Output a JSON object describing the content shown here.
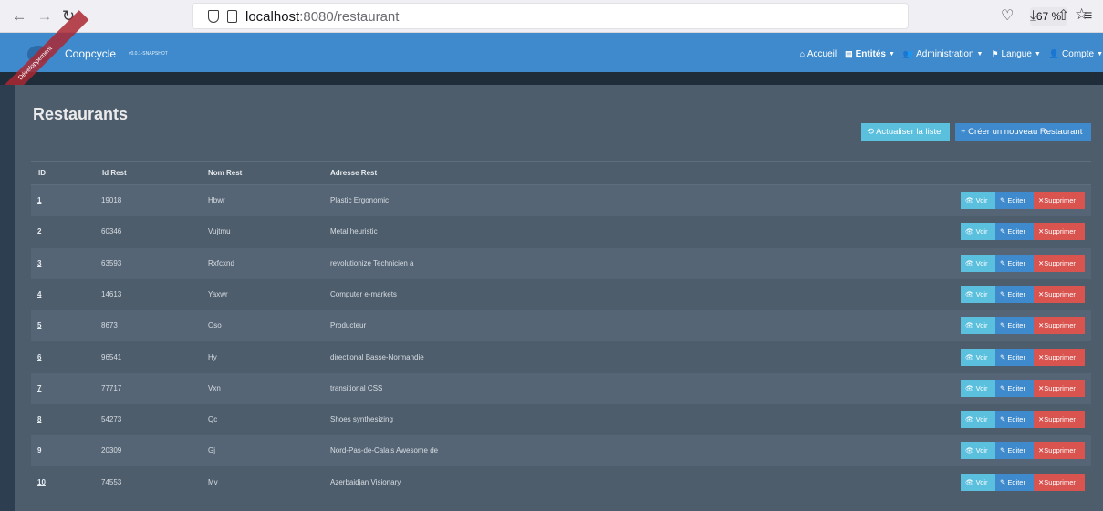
{
  "browser": {
    "url_host": "localhost",
    "url_path": ":8080/restaurant",
    "zoom": "67 %"
  },
  "app": {
    "brand": "Coopcycle",
    "version": "v0.0.1-SNAPSHOT",
    "ribbon": "Développement",
    "nav": {
      "home": "Accueil",
      "entities": "Entités",
      "admin": "Administration",
      "language": "Langue",
      "account": "Compte"
    }
  },
  "page": {
    "title": "Restaurants",
    "refresh_label": "Actualiser la liste",
    "create_label": "+ Créer un nouveau Restaurant"
  },
  "table": {
    "headers": [
      "ID",
      "Id Rest",
      "Nom Rest",
      "Adresse Rest"
    ],
    "rows": [
      {
        "id": "1",
        "idRest": "19018",
        "nom": "Hbwr",
        "adresse": "Plastic Ergonomic"
      },
      {
        "id": "2",
        "idRest": "60346",
        "nom": "Vujtmu",
        "adresse": "Metal heuristic"
      },
      {
        "id": "3",
        "idRest": "63593",
        "nom": "Rxfcxnd",
        "adresse": "revolutionize Technicien a"
      },
      {
        "id": "4",
        "idRest": "14613",
        "nom": "Yaxwr",
        "adresse": "Computer e-markets"
      },
      {
        "id": "5",
        "idRest": "8673",
        "nom": "Oso",
        "adresse": "Producteur"
      },
      {
        "id": "6",
        "idRest": "96541",
        "nom": "Hy",
        "adresse": "directional Basse-Normandie"
      },
      {
        "id": "7",
        "idRest": "77717",
        "nom": "Vxn",
        "adresse": "transitional CSS"
      },
      {
        "id": "8",
        "idRest": "54273",
        "nom": "Qc",
        "adresse": "Shoes synthesizing"
      },
      {
        "id": "9",
        "idRest": "20309",
        "nom": "Gj",
        "adresse": "Nord-Pas-de-Calais Awesome de"
      },
      {
        "id": "10",
        "idRest": "74553",
        "nom": "Mv",
        "adresse": "Azerbaidjan Visionary"
      }
    ],
    "actions": {
      "view": "Voir",
      "edit": "Editer",
      "delete": "Supprimer"
    }
  },
  "colors": {
    "navbar": "#3e8acc",
    "panel": "#4e5d6c",
    "info": "#5bc0de",
    "danger": "#d9534f"
  }
}
